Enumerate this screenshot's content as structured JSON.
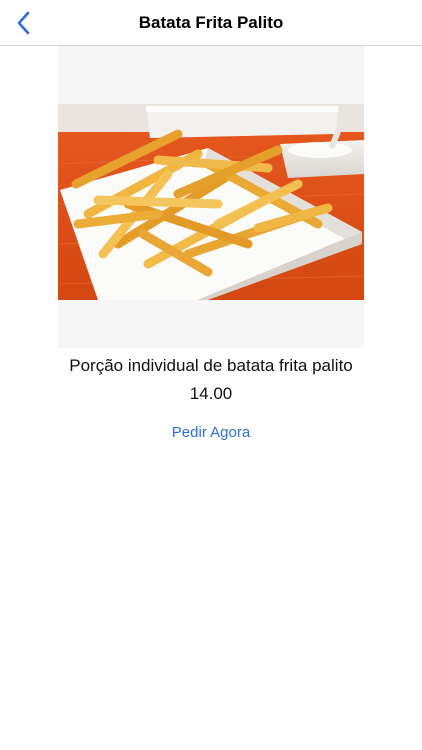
{
  "navbar": {
    "title": "Batata Frita Palito",
    "back_icon": "chevron-left-icon"
  },
  "product": {
    "image_icon": "french-fries-photo",
    "description": "Porção individual de batata frita palito",
    "price": "14.00",
    "order_label": "Pedir Agora"
  },
  "colors": {
    "accent": "#2a6ed6",
    "navbar_border": "#d6d6d6",
    "image_background": "#f6f6f6"
  }
}
